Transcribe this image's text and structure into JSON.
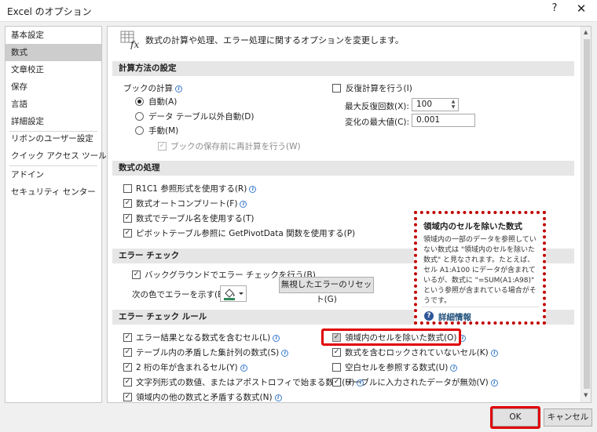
{
  "window": {
    "title": "Excel のオプション",
    "help_glyph": "?",
    "close_glyph": "✕"
  },
  "sidebar": {
    "items": [
      {
        "label": "基本設定"
      },
      {
        "label": "数式",
        "selected": true
      },
      {
        "label": "文章校正"
      },
      {
        "label": "保存"
      },
      {
        "label": "言語"
      },
      {
        "label": "詳細設定"
      },
      {
        "label": "リボンのユーザー設定"
      },
      {
        "label": "クイック アクセス ツール バー"
      },
      {
        "label": "アドイン"
      },
      {
        "label": "セキュリティ センター"
      }
    ]
  },
  "header": {
    "text": "数式の計算や処理、エラー処理に関するオプションを変更します。",
    "icon": "formula-fx-icon"
  },
  "calc": {
    "section": "計算方法の設定",
    "workbook_calc_label": "ブックの計算",
    "auto": "自動(A)",
    "auto_except_tables": "データ テーブル以外自動(D)",
    "manual": "手動(M)",
    "recalc_before_save": "ブックの保存前に再計算を行う(W)",
    "iterative": "反復計算を行う(I)",
    "max_iterations_label": "最大反復回数(X):",
    "max_iterations_value": "100",
    "max_change_label": "変化の最大値(C):",
    "max_change_value": "0.001"
  },
  "formulas": {
    "section": "数式の処理",
    "r1c1": "R1C1 参照形式を使用する(R)",
    "autocomplete": "数式オートコンプリート(F)",
    "table_names": "数式でテーブル名を使用する(T)",
    "getpivotdata": "ピボットテーブル参照に GetPivotData 関数を使用する(P)"
  },
  "error_check": {
    "section": "エラー チェック",
    "background": "バックグラウンドでエラー チェックを行う(B)",
    "color_label": "次の色でエラーを示す(E):",
    "reset_button": "無視したエラーのリセット(G)"
  },
  "rules": {
    "section": "エラー チェック ルール",
    "left": [
      "エラー結果となる数式を含むセル(L)",
      "テーブル内の矛盾した集計列の数式(S)",
      "2 桁の年が含まれるセル(Y)",
      "文字列形式の数値、またはアポストロフィで始まる数値(H)",
      "領域内の他の数式と矛盾する数式(N)"
    ],
    "right": [
      "領域内のセルを除いた数式(O)",
      "数式を含むロックされていないセル(K)",
      "空白セルを参照する数式(U)",
      "テーブルに入力されたデータが無効(V)"
    ]
  },
  "tooltip": {
    "title": "領域内のセルを除いた数式",
    "body": "領域内の一部のデータを参照していない数式は \"領域内のセルを除いた数式\" と見なされます。たとえば、セル A1:A100 にデータが含まれているが、数式に \"=SUM(A1:A98)\" という参照が含まれている場合がそうです。",
    "link": "詳細情報"
  },
  "footer": {
    "ok": "OK",
    "cancel": "キャンセル"
  },
  "colors": {
    "highlight": "#e00000",
    "selected_nav": "#cdcdcd",
    "section_header": "#e6e6e6"
  }
}
